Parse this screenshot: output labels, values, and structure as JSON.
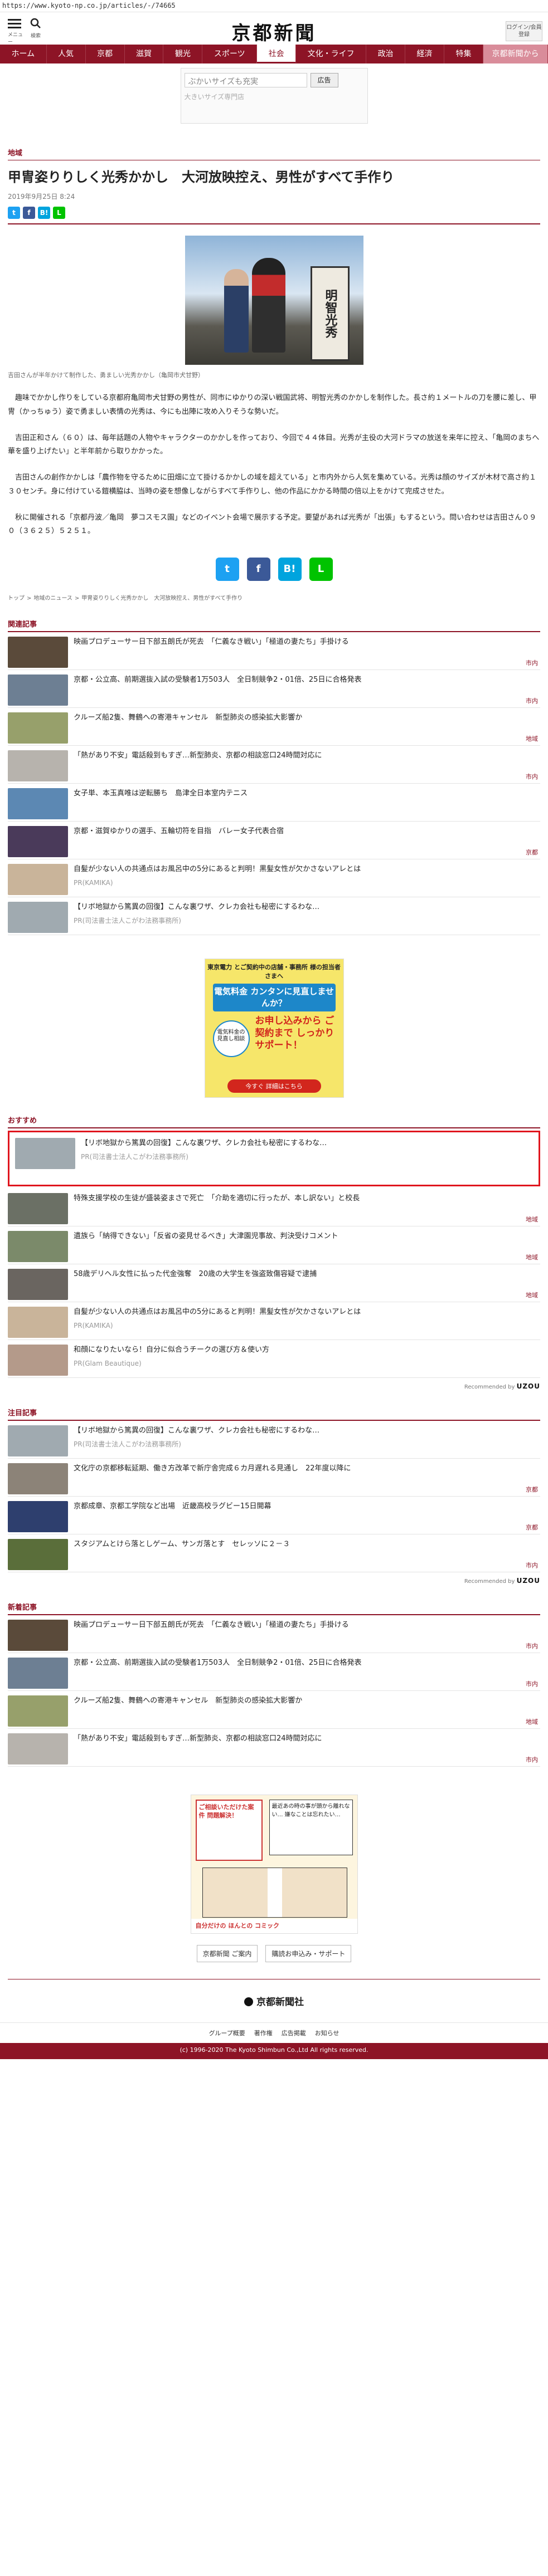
{
  "url": "https://www.kyoto-np.co.jp/articles/-/74665",
  "header": {
    "menu_label": "メニュー",
    "search_label": "検索",
    "logo": "京都新聞",
    "login_label": "ログイン/会員登録"
  },
  "nav": [
    {
      "label": "ホーム"
    },
    {
      "label": "人気"
    },
    {
      "label": "京都"
    },
    {
      "label": "滋賀"
    },
    {
      "label": "観光"
    },
    {
      "label": "スポーツ"
    },
    {
      "label": "社会",
      "active": true
    },
    {
      "label": "文化・ライフ"
    },
    {
      "label": "政治"
    },
    {
      "label": "経済"
    },
    {
      "label": "特集"
    },
    {
      "label": "京都新聞から",
      "special": true
    }
  ],
  "top_ad": {
    "placeholder": "ぶかいサイズも充実",
    "button": "広告",
    "sub": "大きいサイズ専門店"
  },
  "article": {
    "category": "地域",
    "title": "甲冑姿りりしく光秀かかし　大河放映控え、男性がすべて手作り",
    "date": "2019年9月25日 8:24",
    "caption": "吉田さんが半年かけて制作した、勇ましい光秀かかし（亀岡市犬甘野）",
    "photo_sign": "明智光秀",
    "paragraphs": [
      "趣味でかかし作りをしている京都府亀岡市犬甘野の男性が、同市にゆかりの深い戦国武将、明智光秀のかかしを制作した。長さ約１メートルの刀を腰に差し、甲冑（かっちゅう）姿で勇ましい表情の光秀は、今にも出陣に攻め入りそうな勢いだ。",
      "吉田正和さん（６０）は、毎年話題の人物やキャラクターのかかしを作っており、今回で４４体目。光秀が主役の大河ドラマの放送を来年に控え、「亀岡のまちへ華を盛り上げたい」と半年前から取りかかった。",
      "吉田さんの創作かかしは「農作物を守るために田畑に立て掛けるかかしの域を超えている」と市内外から人気を集めている。光秀は顔のサイズが木材で高さ約１３０センチ。身に付けている鎧横脇は、当時の姿を想像しながらすべて手作りし、他の作品にかかる時間の倍以上をかけて完成させた。",
      "秋に開催される「京都丹波／亀岡　夢コスモス園」などのイベント会場で展示する予定。要望があれば光秀が「出張」もするという。問い合わせは吉田さん０９０（３６２５）５２５１。"
    ]
  },
  "share": {
    "twitter": "t",
    "facebook": "f",
    "hatena": "B!",
    "line": "L"
  },
  "breadcrumb": [
    "トップ",
    ">",
    "地域のニュース",
    ">",
    "甲冑姿りりしく光秀かかし　大河放映控え、男性がすべて手作り"
  ],
  "related": {
    "heading": "関連記事",
    "items": [
      {
        "text": "映画プロデューサー日下部五朗氏が死去　「仁義なき戦い」「極道の妻たち」手掛ける",
        "tag": "市内",
        "color": "#5a4a3a"
      },
      {
        "text": "京都・公立高、前期選抜入試の受験者1万503人　全日制競争2・01倍、25日に合格発表",
        "tag": "市内",
        "color": "#6d7f93"
      },
      {
        "text": "クルーズ船2隻、舞鶴への寄港キャンセル　新型肺炎の感染拡大影響か",
        "tag": "地域",
        "color": "#97a06b"
      },
      {
        "text": "「熱があり不安」電話殺到もすぎ…新型肺炎、京都の相談窓口24時間対応に",
        "tag": "市内",
        "color": "#b7b3ad"
      },
      {
        "text": "女子単、本玉真唯は逆転勝ち　島津全日本室内テニス",
        "tag": "",
        "color": "#5c88b3"
      },
      {
        "text": "京都・滋賀ゆかりの選手、五輪切符を目指　バレー女子代表合宿",
        "tag": "京都",
        "color": "#4a3a5a"
      },
      {
        "text": "自髪が少ない人の共通点はお風呂中の5分にあると判明！黒髪女性が欠かさないアレとは",
        "tag": "",
        "pr": "PR(KAMIKA)",
        "color": "#c9b49a"
      },
      {
        "text": "【リボ地獄から篤異の回復】こんな裏ワザ、クレカ会社も秘密にするわな…",
        "tag": "",
        "pr": "PR(司法書士法人こがわ法務事務所)",
        "color": "#a0aab0"
      }
    ]
  },
  "mid_ad": {
    "line1": "東京電力 とご契約中の店舗・事務所 様の担当者さまへ",
    "blue": "電気料金 カンタンに見直しませんか？",
    "red": "お申し込みから ご契約まで しっかりサポート！",
    "badge": "電気料金の 見直し相談",
    "cta": "今すぐ 詳細はこちら"
  },
  "recommend": {
    "heading": "おすすめ",
    "highlight": {
      "text": "【リボ地獄から篤異の回復】こんな裏ワザ、クレカ会社も秘密にするわな…",
      "pr": "PR(司法書士法人こがわ法務事務所)",
      "color": "#a0aab0"
    },
    "items": [
      {
        "text": "特殊支援学校の生徒が盛装姿まさで死亡　「介助を適切に行ったが、本し訳ない」と校長",
        "tag": "地域",
        "color": "#6b7065"
      },
      {
        "text": "遺族ら「納得できない」「反省の姿見せるべき」大津園児事故、判決受けコメント",
        "tag": "地域",
        "color": "#7b8a6a"
      },
      {
        "text": "58歳デリヘル女性に払った代金強奪　20歳の大学生を強盗致傷容疑で逮捕",
        "tag": "地域",
        "color": "#6a6560"
      },
      {
        "text": "自髪が少ない人の共通点はお風呂中の5分にあると判明！黒髪女性が欠かさないアレとは",
        "tag": "",
        "pr": "PR(KAMIKA)",
        "color": "#c9b49a"
      },
      {
        "text": "和顔になりたいなら！自分に似合うチークの選び方＆使い方",
        "tag": "",
        "pr": "PR(Glam Beautique)",
        "color": "#b49a8a"
      }
    ],
    "credit_prefix": "Recommended by",
    "credit_brand": "UZOU"
  },
  "attention": {
    "heading": "注目記事",
    "items": [
      {
        "text": "【リボ地獄から篤異の回復】こんな裏ワザ、クレカ会社も秘密にするわな…",
        "tag": "",
        "pr": "PR(司法書士法人こがわ法務事務所)",
        "color": "#a0aab0"
      },
      {
        "text": "文化庁の京都移転延期、働き方改革で新庁舎完成６カ月遅れる見通し　22年度以降に",
        "tag": "京都",
        "color": "#8c8378"
      },
      {
        "text": "京都成章、京都工学院など出場　近畿高校ラグビー15日開幕",
        "tag": "京都",
        "color": "#2e3f6e"
      },
      {
        "text": "スタジアムとけら落としゲーム、サンガ落とす　セレッソに２－３",
        "tag": "市内",
        "color": "#5a6e3a"
      }
    ],
    "credit_prefix": "Recommended by",
    "credit_brand": "UZOU"
  },
  "latest": {
    "heading": "新着記事",
    "items": [
      {
        "text": "映画プロデューサー日下部五朗氏が死去　「仁義なき戦い」「極道の妻たち」手掛ける",
        "tag": "市内",
        "color": "#5a4a3a"
      },
      {
        "text": "京都・公立高、前期選抜入試の受験者1万503人　全日制競争2・01倍、25日に合格発表",
        "tag": "市内",
        "color": "#6d7f93"
      },
      {
        "text": "クルーズ船2隻、舞鶴への寄港キャンセル　新型肺炎の感染拡大影響か",
        "tag": "地域",
        "color": "#97a06b"
      },
      {
        "text": "「熱があり不安」電話殺到もすぎ…新型肺炎、京都の相談窓口24時間対応に",
        "tag": "市内",
        "color": "#b7b3ad"
      }
    ]
  },
  "bottom_ad": {
    "head": "ご相談いただけた案件 問題解決！",
    "head2": "最近あの時の事が頭から離れない… 嫌なことは忘れたい…",
    "foot": "自分だけの ほんとの コミック"
  },
  "footer_links": [
    "京都新聞 ご案内",
    "購読お申込み・サポート"
  ],
  "brand": "京都新聞社",
  "footer_nav": [
    "グループ概要",
    "著作権",
    "広告掲載",
    "お知らせ"
  ],
  "copyright": "(c) 1996-2020 The Kyoto Shimbun Co.,Ltd All rights reserved."
}
